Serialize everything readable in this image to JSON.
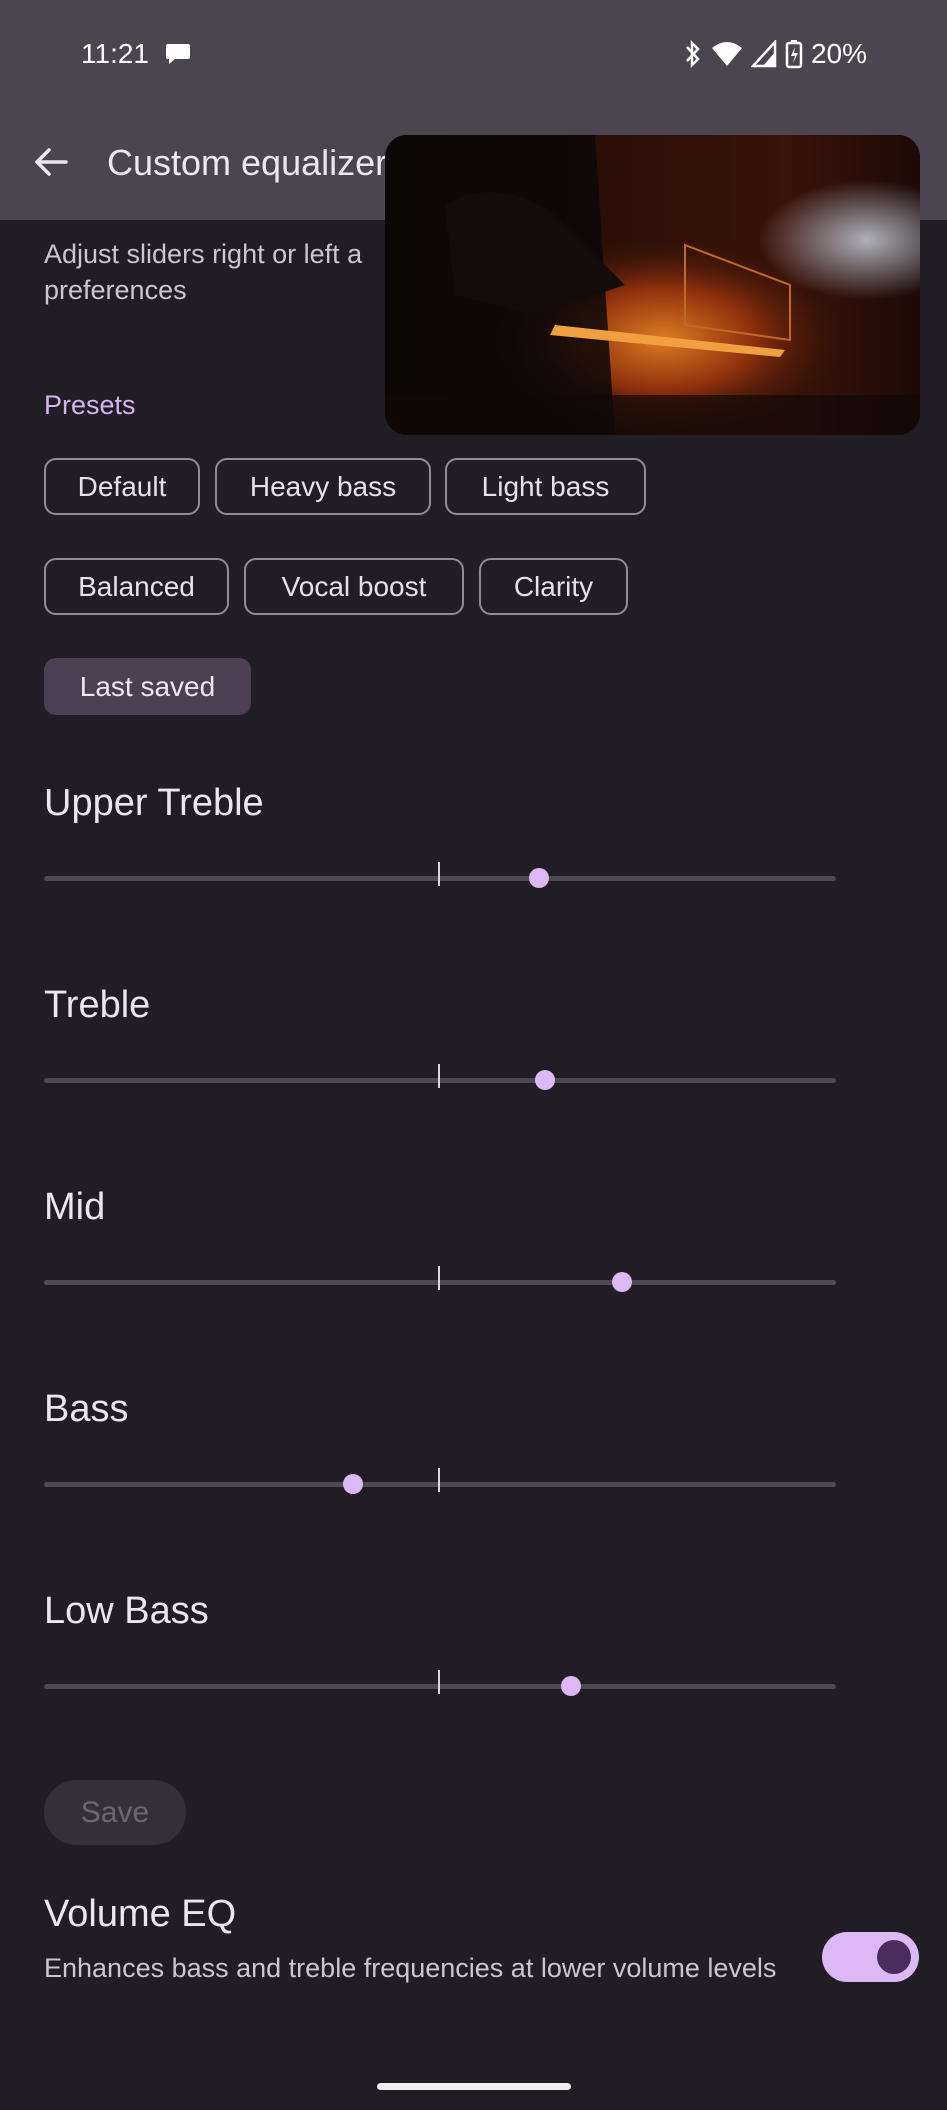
{
  "status": {
    "time": "11:21",
    "battery": "20%"
  },
  "appbar": {
    "title": "Custom equalizer"
  },
  "description": "Adjust sliders right or left a preferences",
  "presets": {
    "label": "Presets",
    "chips": [
      "Default",
      "Heavy bass",
      "Light bass",
      "Balanced",
      "Vocal boost",
      "Clarity",
      "Last saved"
    ],
    "selected": "Last saved"
  },
  "bands": [
    {
      "label": "Upper Treble",
      "value": 0.625
    },
    {
      "label": "Treble",
      "value": 0.633
    },
    {
      "label": "Mid",
      "value": 0.73
    },
    {
      "label": "Bass",
      "value": 0.39
    },
    {
      "label": "Low Bass",
      "value": 0.665
    }
  ],
  "save_label": "Save",
  "volume_eq": {
    "title": "Volume EQ",
    "description": "Enhances bass and treble frequencies at lower volume levels",
    "enabled": true
  },
  "colors": {
    "accent": "#dcb8f4",
    "background": "#201d24",
    "bar": "#4a454f"
  },
  "icons": [
    "chat-bubble-icon",
    "bluetooth-icon",
    "wifi-icon",
    "cellular-signal-icon",
    "battery-icon",
    "back-arrow-icon",
    "overflow-icon"
  ]
}
